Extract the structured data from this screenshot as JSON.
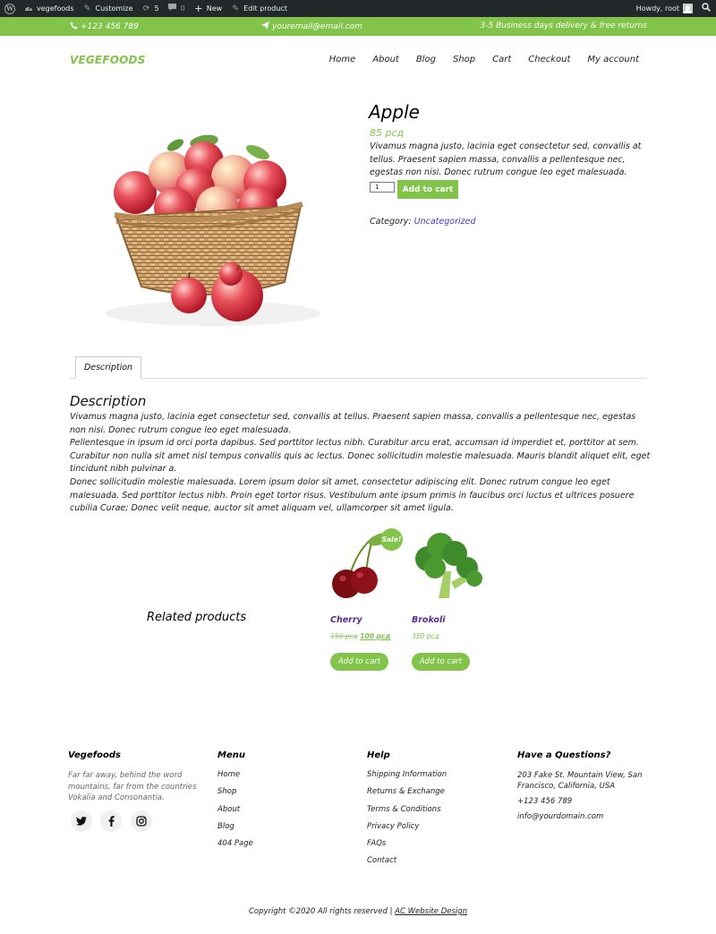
{
  "admin_bar": {
    "site_name": "vegefoods",
    "customize": "Customize",
    "updates_count": "5",
    "comments_count": "0",
    "new_label": "New",
    "edit_label": "Edit product",
    "greeting": "Howdy, root"
  },
  "top_strip": {
    "phone": "+123 456 789",
    "email": "youremail@email.com",
    "delivery": "3-5 Business days delivery & free returns"
  },
  "header": {
    "brand": "VEGEFOODS",
    "nav": [
      "Home",
      "About",
      "Blog",
      "Shop",
      "Cart",
      "Checkout",
      "My account"
    ]
  },
  "product": {
    "title": "Apple",
    "price": "85 рсд",
    "short_description": "Vivamus magna justo, lacinia eget consectetur sed, convallis at tellus. Praesent sapien massa, convallis a pellentesque nec, egestas non nisi. Donec rutrum congue leo eget malesuada.",
    "quantity": "1",
    "add_to_cart": "Add to cart",
    "category_label": "Category:",
    "category": "Uncategorized"
  },
  "tabs": {
    "description_tab": "Description",
    "description_heading": "Description",
    "paragraphs": [
      "Vivamus magna justo, lacinia eget consectetur sed, convallis at tellus. Praesent sapien massa, convallis a pellentesque nec, egestas non nisi. Donec rutrum congue leo eget malesuada.",
      "Pellentesque in ipsum id orci porta dapibus. Sed porttitor lectus nibh. Curabitur arcu erat, accumsan id imperdiet et, porttitor at sem. Curabitur non nulla sit amet nisl tempus convallis quis ac lectus. Donec sollicitudin molestie malesuada. Mauris blandit aliquet elit, eget tincidunt nibh pulvinar a.",
      "Donec sollicitudin molestie malesuada. Lorem ipsum dolor sit amet, consectetur adipiscing elit. Donec rutrum congue leo eget malesuada. Sed porttitor lectus nibh. Proin eget tortor risus. Vestibulum ante ipsum primis in faucibus orci luctus et ultrices posuere cubilia Curae; Donec velit neque, auctor sit amet aliquam vel, ullamcorper sit amet ligula."
    ]
  },
  "related": {
    "heading": "Related products",
    "items": [
      {
        "name": "Cherry",
        "old_price": "150 рсд",
        "price": "100 рсд",
        "sale_badge": "Sale!",
        "button": "Add to cart"
      },
      {
        "name": "Brokoli",
        "price": "350 рсд",
        "button": "Add to cart"
      }
    ]
  },
  "footer": {
    "brand": "Vegefoods",
    "about": "Far far away, behind the word mountains, far from the countries Vokalia and Consonantia.",
    "menu_heading": "Menu",
    "menu": [
      "Home",
      "Shop",
      "About",
      "Blog",
      "404 Page"
    ],
    "help_heading": "Help",
    "help": [
      "Shipping Information",
      "Returns & Exchange",
      "Terms & Conditions",
      "Privacy Policy",
      "FAQs",
      "Contact"
    ],
    "contact_heading": "Have a Questions?",
    "address": "203 Fake St. Mountain View, San Francisco, California, USA",
    "phone": "+123 456 789",
    "email": "info@yourdomain.com",
    "copyright_prefix": "Copyright ©2020 All rights reserved | ",
    "copyright_link": "AC Website Design"
  },
  "icons": {
    "social": [
      "twitter-icon",
      "facebook-icon",
      "instagram-icon"
    ]
  },
  "colors": {
    "accent": "#82c34a",
    "admin_bar": "#23282d",
    "related_name": "#5a2a8c"
  }
}
